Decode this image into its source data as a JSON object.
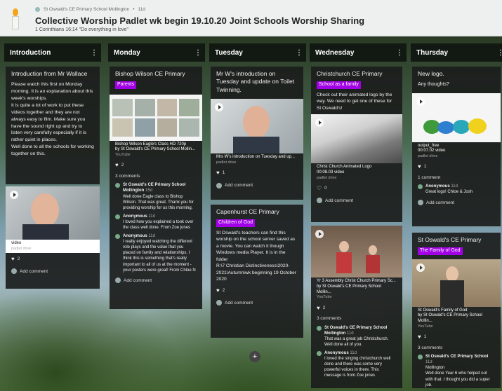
{
  "header": {
    "meta_author": "St Oswald's CE Primary School Mollington",
    "meta_time": "11d",
    "title": "Collective Worship Padlet wk begin 19.10.20 Joint Schools Worship Sharing",
    "subtitle": "1 Corinthians 16:14 \"Do everything in love\""
  },
  "columns": [
    {
      "title": "Introduction"
    },
    {
      "title": "Monday"
    },
    {
      "title": "Tuesday"
    },
    {
      "title": "Wednesday"
    },
    {
      "title": "Thursday"
    }
  ],
  "cards": {
    "intro": {
      "title": "Introduction from Mr Wallace",
      "body": "Please watch this first on Monday morning. It is an explanation about this week's worships.\nIt is quite a lot of work to put these videos together and they are not always easy to film.  Make sure you have the sound right up and try to listen very carefully especially if it is rather quiet in places.\nWell done to all the schools for working together on this."
    },
    "intro_video": {
      "label": "video",
      "source": "padlet drive",
      "likes": "2",
      "add_comment": "Add comment"
    },
    "monday": {
      "title": "Bishop Wilson CE Primary",
      "tag": "Parents",
      "video_title": "Bishop Wilson Eagle's Class HD 720p",
      "video_by": "by St Oswald's CE Primary School Mollin...",
      "source": "YouTube",
      "likes": "2",
      "comment_count": "3 comments",
      "comments": [
        {
          "who": "St Oswald's CE Primary School Mollington",
          "when": "15d",
          "text": "Well done Eagle class to Bishop Wilson. That was great. Thank you for providing worship for us this morning."
        },
        {
          "who": "Anonymous",
          "when": "11d",
          "text": "I loved how you explained a took over the class well done. From Zoe jones"
        },
        {
          "who": "Anonymous",
          "when": "11d",
          "text": "I really enjoyed watching the different role plays and the value that you placed on family and relationships. I think this is something that's really important to all of us at the moment - your posters were great! From Chloe N"
        }
      ],
      "add_comment": "Add comment"
    },
    "tuesday": {
      "title": "Mr W's introduction on Tuesday and update on Toilet Twinning.",
      "video_title": "Mrs W's introduction on Tuesday and up...",
      "source": "padlet drive",
      "likes": "1",
      "add_comment": "Add comment"
    },
    "tuesday2": {
      "title": "Capenhurst CE Primary",
      "tag": "Children of God",
      "body": "St Oswald's teachers can find this worship on the school server saved as a movie. You can watch it though Windows media Player. It is in the folder\nR:\\7 Christian Distinctiveness\\2020-2021\\Autumn\\wk beginning 19 October 2020",
      "likes": "2",
      "add_comment": "Add comment"
    },
    "wednesday": {
      "title": "Christchurch CE Primary",
      "tag": "School as a family",
      "body": "Check out their animated logo by the way. We need to get one of these for St Oswald's!",
      "video_title": "Christ Church Animated Logo",
      "video_len": "00:08.03 video",
      "source": "padlet drive",
      "likes": "0",
      "add_comment": "Add comment"
    },
    "wednesday2": {
      "video_title": "Yr 3 Assembly Christ Church Primary Sc...",
      "video_by": "by St Oswald's CE Primary School Mollin...",
      "source": "YouTube",
      "likes": "2",
      "comment_count": "3 comments",
      "comments": [
        {
          "who": "St Oswald's CE Primary School Mollington",
          "when": "11d",
          "text": "That was a great job Christchurch. Well done all of you."
        },
        {
          "who": "Anonymous",
          "when": "11d",
          "text": "I loved the singing christchurch well done and there was some very powerful voices in there. This message is from Zoe jones"
        }
      ]
    },
    "thursday": {
      "title": "New logo.",
      "body": "Any thoughts?",
      "file": "output_free",
      "video_len": "00:07.02 video",
      "source": "padlet drive",
      "likes": "1",
      "comment_count": "1 comment",
      "comments": [
        {
          "who": "Anonymous",
          "when": "11d",
          "text": "Great logo! Chloe & Josh"
        }
      ],
      "add_comment": "Add comment"
    },
    "thursday2": {
      "title": "St Oswald's CE Primary",
      "tag": "The Family of God",
      "video_title": "St Oswald's Family of God",
      "video_by": "by St Oswald's CE Primary School Mollin...",
      "source": "YouTube",
      "likes": "1",
      "comment_count": "3 comments",
      "comments": [
        {
          "who": "St Oswald's CE Primary School",
          "when": "11d",
          "text": "Mollington\nWell done Year 6 who helped out with that. I thought you did a super job."
        }
      ]
    }
  },
  "fab": "+"
}
